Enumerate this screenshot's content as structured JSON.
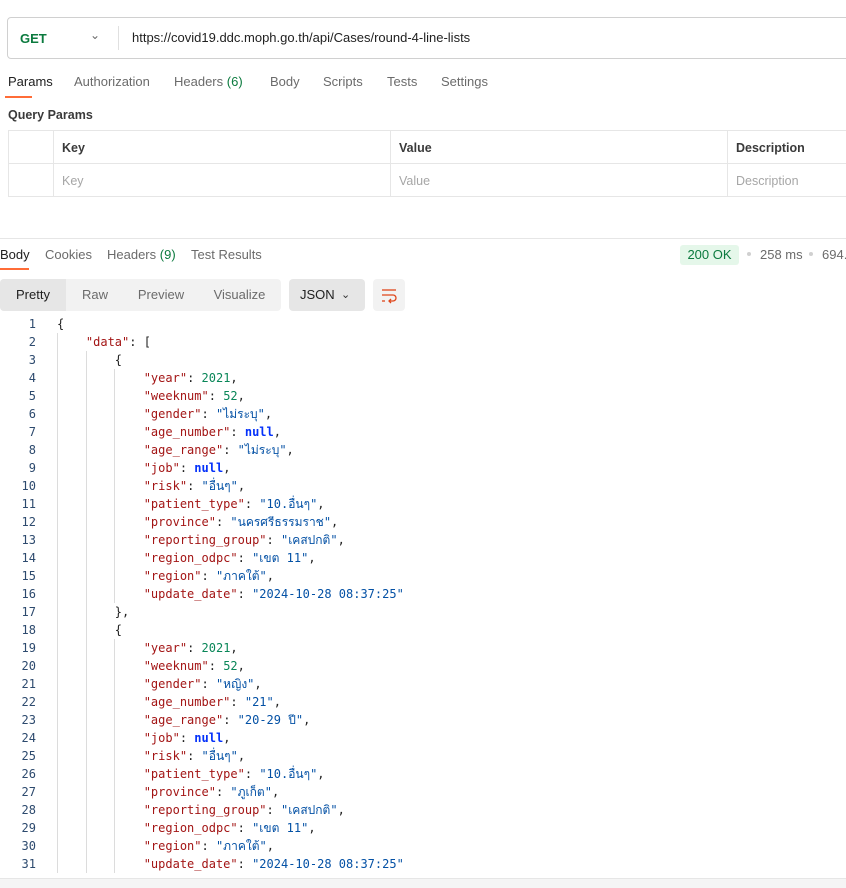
{
  "request": {
    "method": "GET",
    "url": "https://covid19.ddc.moph.go.th/api/Cases/round-4-line-lists"
  },
  "request_tabs": [
    {
      "label": "Params"
    },
    {
      "label": "Authorization"
    },
    {
      "label": "Headers",
      "count": "(6)"
    },
    {
      "label": "Body"
    },
    {
      "label": "Scripts"
    },
    {
      "label": "Tests"
    },
    {
      "label": "Settings"
    }
  ],
  "query_params": {
    "title": "Query Params",
    "headers": [
      "Key",
      "Value",
      "Description"
    ],
    "placeholders": [
      "Key",
      "Value",
      "Description"
    ]
  },
  "response_tabs": [
    {
      "label": "Body"
    },
    {
      "label": "Cookies"
    },
    {
      "label": "Headers",
      "count": "(9)"
    },
    {
      "label": "Test Results"
    }
  ],
  "response_meta": {
    "status": "200 OK",
    "time": "258 ms",
    "size": "694."
  },
  "view_modes": [
    "Pretty",
    "Raw",
    "Preview",
    "Visualize"
  ],
  "format": "JSON",
  "icons": {
    "wrap": "wrap-lines-icon",
    "chevron": "chevron-down-icon"
  },
  "colors": {
    "accent": "#ff6c37",
    "method": "#0b7a3e",
    "key": "#a31515",
    "string": "#0451a5",
    "number": "#098658",
    "null": "#0431fa"
  },
  "code_lines": [
    {
      "i": 0,
      "t": [
        [
          "p",
          "{"
        ]
      ]
    },
    {
      "i": 1,
      "t": [
        [
          "k",
          "\"data\""
        ],
        [
          "p",
          ": ["
        ]
      ]
    },
    {
      "i": 2,
      "t": [
        [
          "p",
          "{"
        ]
      ]
    },
    {
      "i": 3,
      "t": [
        [
          "k",
          "\"year\""
        ],
        [
          "p",
          ": "
        ],
        [
          "n",
          "2021"
        ],
        [
          "p",
          ","
        ]
      ]
    },
    {
      "i": 3,
      "t": [
        [
          "k",
          "\"weeknum\""
        ],
        [
          "p",
          ": "
        ],
        [
          "n",
          "52"
        ],
        [
          "p",
          ","
        ]
      ]
    },
    {
      "i": 3,
      "t": [
        [
          "k",
          "\"gender\""
        ],
        [
          "p",
          ": "
        ],
        [
          "s",
          "\"ไม่ระบุ\""
        ],
        [
          "p",
          ","
        ]
      ]
    },
    {
      "i": 3,
      "t": [
        [
          "k",
          "\"age_number\""
        ],
        [
          "p",
          ": "
        ],
        [
          "l",
          "null"
        ],
        [
          "p",
          ","
        ]
      ]
    },
    {
      "i": 3,
      "t": [
        [
          "k",
          "\"age_range\""
        ],
        [
          "p",
          ": "
        ],
        [
          "s",
          "\"ไม่ระบุ\""
        ],
        [
          "p",
          ","
        ]
      ]
    },
    {
      "i": 3,
      "t": [
        [
          "k",
          "\"job\""
        ],
        [
          "p",
          ": "
        ],
        [
          "l",
          "null"
        ],
        [
          "p",
          ","
        ]
      ]
    },
    {
      "i": 3,
      "t": [
        [
          "k",
          "\"risk\""
        ],
        [
          "p",
          ": "
        ],
        [
          "s",
          "\"อื่นๆ\""
        ],
        [
          "p",
          ","
        ]
      ]
    },
    {
      "i": 3,
      "t": [
        [
          "k",
          "\"patient_type\""
        ],
        [
          "p",
          ": "
        ],
        [
          "s",
          "\"10.อื่นๆ\""
        ],
        [
          "p",
          ","
        ]
      ]
    },
    {
      "i": 3,
      "t": [
        [
          "k",
          "\"province\""
        ],
        [
          "p",
          ": "
        ],
        [
          "s",
          "\"นครศรีธรรมราช\""
        ],
        [
          "p",
          ","
        ]
      ]
    },
    {
      "i": 3,
      "t": [
        [
          "k",
          "\"reporting_group\""
        ],
        [
          "p",
          ": "
        ],
        [
          "s",
          "\"เคสปกติ\""
        ],
        [
          "p",
          ","
        ]
      ]
    },
    {
      "i": 3,
      "t": [
        [
          "k",
          "\"region_odpc\""
        ],
        [
          "p",
          ": "
        ],
        [
          "s",
          "\"เขต 11\""
        ],
        [
          "p",
          ","
        ]
      ]
    },
    {
      "i": 3,
      "t": [
        [
          "k",
          "\"region\""
        ],
        [
          "p",
          ": "
        ],
        [
          "s",
          "\"ภาคใต้\""
        ],
        [
          "p",
          ","
        ]
      ]
    },
    {
      "i": 3,
      "t": [
        [
          "k",
          "\"update_date\""
        ],
        [
          "p",
          ": "
        ],
        [
          "s",
          "\"2024-10-28 08:37:25\""
        ]
      ]
    },
    {
      "i": 2,
      "t": [
        [
          "p",
          "},"
        ]
      ]
    },
    {
      "i": 2,
      "t": [
        [
          "p",
          "{"
        ]
      ]
    },
    {
      "i": 3,
      "t": [
        [
          "k",
          "\"year\""
        ],
        [
          "p",
          ": "
        ],
        [
          "n",
          "2021"
        ],
        [
          "p",
          ","
        ]
      ]
    },
    {
      "i": 3,
      "t": [
        [
          "k",
          "\"weeknum\""
        ],
        [
          "p",
          ": "
        ],
        [
          "n",
          "52"
        ],
        [
          "p",
          ","
        ]
      ]
    },
    {
      "i": 3,
      "t": [
        [
          "k",
          "\"gender\""
        ],
        [
          "p",
          ": "
        ],
        [
          "s",
          "\"หญิง\""
        ],
        [
          "p",
          ","
        ]
      ]
    },
    {
      "i": 3,
      "t": [
        [
          "k",
          "\"age_number\""
        ],
        [
          "p",
          ": "
        ],
        [
          "s",
          "\"21\""
        ],
        [
          "p",
          ","
        ]
      ]
    },
    {
      "i": 3,
      "t": [
        [
          "k",
          "\"age_range\""
        ],
        [
          "p",
          ": "
        ],
        [
          "s",
          "\"20-29 ปี\""
        ],
        [
          "p",
          ","
        ]
      ]
    },
    {
      "i": 3,
      "t": [
        [
          "k",
          "\"job\""
        ],
        [
          "p",
          ": "
        ],
        [
          "l",
          "null"
        ],
        [
          "p",
          ","
        ]
      ]
    },
    {
      "i": 3,
      "t": [
        [
          "k",
          "\"risk\""
        ],
        [
          "p",
          ": "
        ],
        [
          "s",
          "\"อื่นๆ\""
        ],
        [
          "p",
          ","
        ]
      ]
    },
    {
      "i": 3,
      "t": [
        [
          "k",
          "\"patient_type\""
        ],
        [
          "p",
          ": "
        ],
        [
          "s",
          "\"10.อื่นๆ\""
        ],
        [
          "p",
          ","
        ]
      ]
    },
    {
      "i": 3,
      "t": [
        [
          "k",
          "\"province\""
        ],
        [
          "p",
          ": "
        ],
        [
          "s",
          "\"ภูเก็ต\""
        ],
        [
          "p",
          ","
        ]
      ]
    },
    {
      "i": 3,
      "t": [
        [
          "k",
          "\"reporting_group\""
        ],
        [
          "p",
          ": "
        ],
        [
          "s",
          "\"เคสปกติ\""
        ],
        [
          "p",
          ","
        ]
      ]
    },
    {
      "i": 3,
      "t": [
        [
          "k",
          "\"region_odpc\""
        ],
        [
          "p",
          ": "
        ],
        [
          "s",
          "\"เขต 11\""
        ],
        [
          "p",
          ","
        ]
      ]
    },
    {
      "i": 3,
      "t": [
        [
          "k",
          "\"region\""
        ],
        [
          "p",
          ": "
        ],
        [
          "s",
          "\"ภาคใต้\""
        ],
        [
          "p",
          ","
        ]
      ]
    },
    {
      "i": 3,
      "t": [
        [
          "k",
          "\"update_date\""
        ],
        [
          "p",
          ": "
        ],
        [
          "s",
          "\"2024-10-28 08:37:25\""
        ]
      ]
    }
  ]
}
